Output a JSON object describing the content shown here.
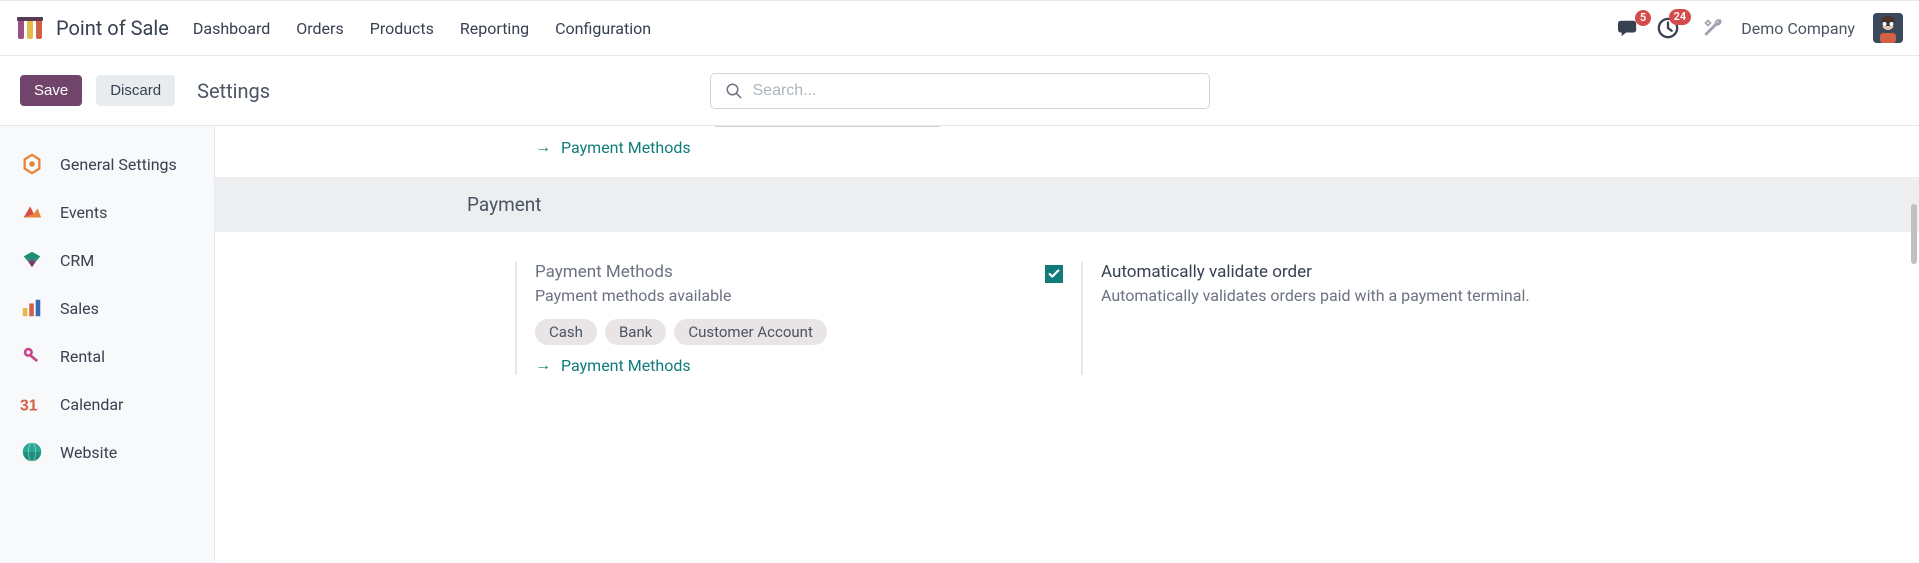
{
  "app": {
    "name": "Point of Sale"
  },
  "nav": {
    "items": [
      "Dashboard",
      "Orders",
      "Products",
      "Reporting",
      "Configuration"
    ]
  },
  "navbar_right": {
    "messages_badge": "5",
    "activities_badge": "24",
    "company": "Demo Company"
  },
  "controls": {
    "save": "Save",
    "discard": "Discard",
    "title": "Settings"
  },
  "search": {
    "placeholder": "Search..."
  },
  "sidebar": {
    "items": [
      {
        "label": "General Settings"
      },
      {
        "label": "Events"
      },
      {
        "label": "CRM"
      },
      {
        "label": "Sales"
      },
      {
        "label": "Rental"
      },
      {
        "label": "Calendar"
      },
      {
        "label": "Website"
      }
    ]
  },
  "content": {
    "top_link": "Payment Methods",
    "section_header": "Payment",
    "left": {
      "title": "Payment Methods",
      "desc": "Payment methods available",
      "tags": [
        "Cash",
        "Bank",
        "Customer Account"
      ],
      "link": "Payment Methods"
    },
    "right": {
      "checked": true,
      "title": "Automatically validate order",
      "desc": "Automatically validates orders paid with a payment terminal."
    }
  }
}
